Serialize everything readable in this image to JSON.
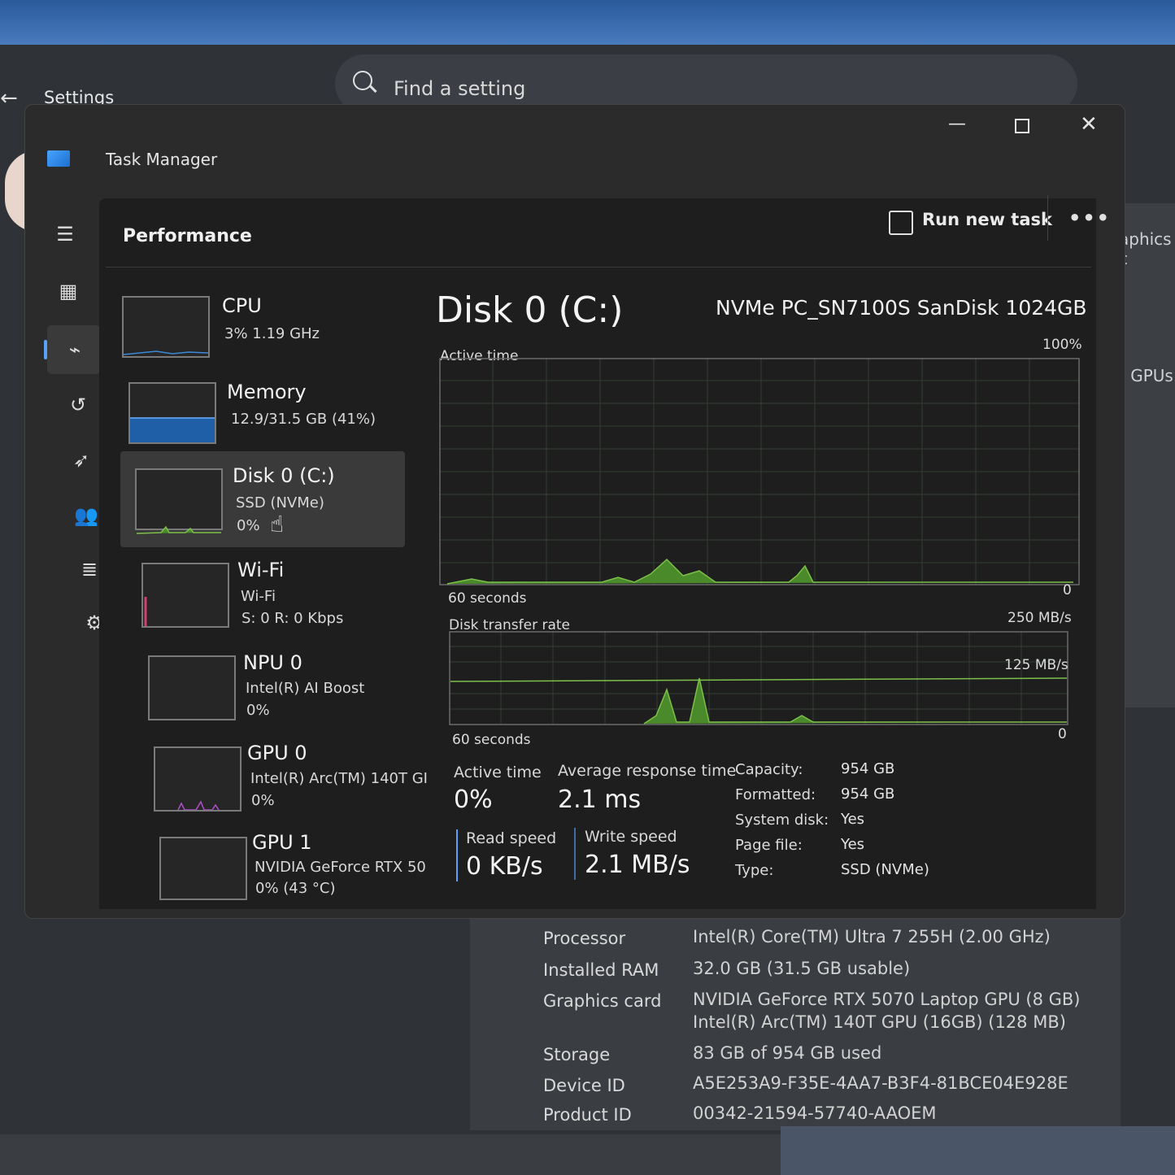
{
  "settings": {
    "title": "Settings",
    "search_placeholder": "Find a setting",
    "fragments": {
      "graphics": "aphics c",
      "gpus": "le GPUs"
    },
    "system_specs": [
      {
        "label": "Processor",
        "value": "Intel(R) Core(TM) Ultra 7 255H (2.00 GHz)"
      },
      {
        "label": "Installed RAM",
        "value": "32.0 GB (31.5 GB usable)"
      },
      {
        "label": "Graphics card",
        "value": "NVIDIA GeForce RTX 5070 Laptop GPU (8 GB)",
        "value2": "Intel(R) Arc(TM) 140T GPU (16GB) (128 MB)"
      },
      {
        "label": "Storage",
        "value": "83 GB of 954 GB used"
      },
      {
        "label": "Device ID",
        "value": "A5E253A9-F35E-4AA7-B3F4-81BCE04E928E"
      },
      {
        "label": "Product ID",
        "value": "00342-21594-57740-AAOEM"
      }
    ]
  },
  "taskmanager": {
    "title": "Task Manager",
    "page_title": "Performance",
    "run_new_task": "Run new task",
    "more": "•••",
    "resources": [
      {
        "name": "CPU",
        "line1": "3%  1.19 GHz",
        "line2": ""
      },
      {
        "name": "Memory",
        "line1": "12.9/31.5 GB (41%)",
        "line2": ""
      },
      {
        "name": "Disk 0 (C:)",
        "line1": "SSD (NVMe)",
        "line2": "0%"
      },
      {
        "name": "Wi-Fi",
        "line1": "Wi-Fi",
        "line2": "S: 0  R: 0 Kbps"
      },
      {
        "name": "NPU 0",
        "line1": "Intel(R) AI Boost",
        "line2": "0%"
      },
      {
        "name": "GPU 0",
        "line1": "Intel(R) Arc(TM) 140T GI",
        "line2": "0%"
      },
      {
        "name": "GPU 1",
        "line1": "NVIDIA GeForce RTX 50",
        "line2": "0%  (43 °C)"
      }
    ],
    "detail": {
      "title": "Disk 0 (C:)",
      "model": "NVMe PC_SN7100S SanDisk 1024GB",
      "active_time_label": "Active time",
      "active_max": "100%",
      "active_min": "0",
      "seconds_label": "60 seconds",
      "transfer_label": "Disk transfer rate",
      "transfer_max": "250 MB/s",
      "transfer_mid": "125 MB/s",
      "transfer_min": "0",
      "seconds_label2": "60 seconds",
      "stats": {
        "active_time": {
          "label": "Active time",
          "value": "0%"
        },
        "avg_response": {
          "label": "Average response time",
          "value": "2.1 ms"
        },
        "read_speed": {
          "label": "Read speed",
          "value": "0 KB/s"
        },
        "write_speed": {
          "label": "Write speed",
          "value": "2.1 MB/s"
        }
      },
      "properties": [
        {
          "label": "Capacity:",
          "value": "954 GB"
        },
        {
          "label": "Formatted:",
          "value": "954 GB"
        },
        {
          "label": "System disk:",
          "value": "Yes"
        },
        {
          "label": "Page file:",
          "value": "Yes"
        },
        {
          "label": "Type:",
          "value": "SSD (NVMe)"
        }
      ]
    }
  },
  "colors": {
    "accent": "#5aa0ff",
    "disk_green": "#7cc04a",
    "memory_blue": "#1f5fa8",
    "wifi_pink": "#d04070",
    "gpu_purple": "#b050d0"
  }
}
